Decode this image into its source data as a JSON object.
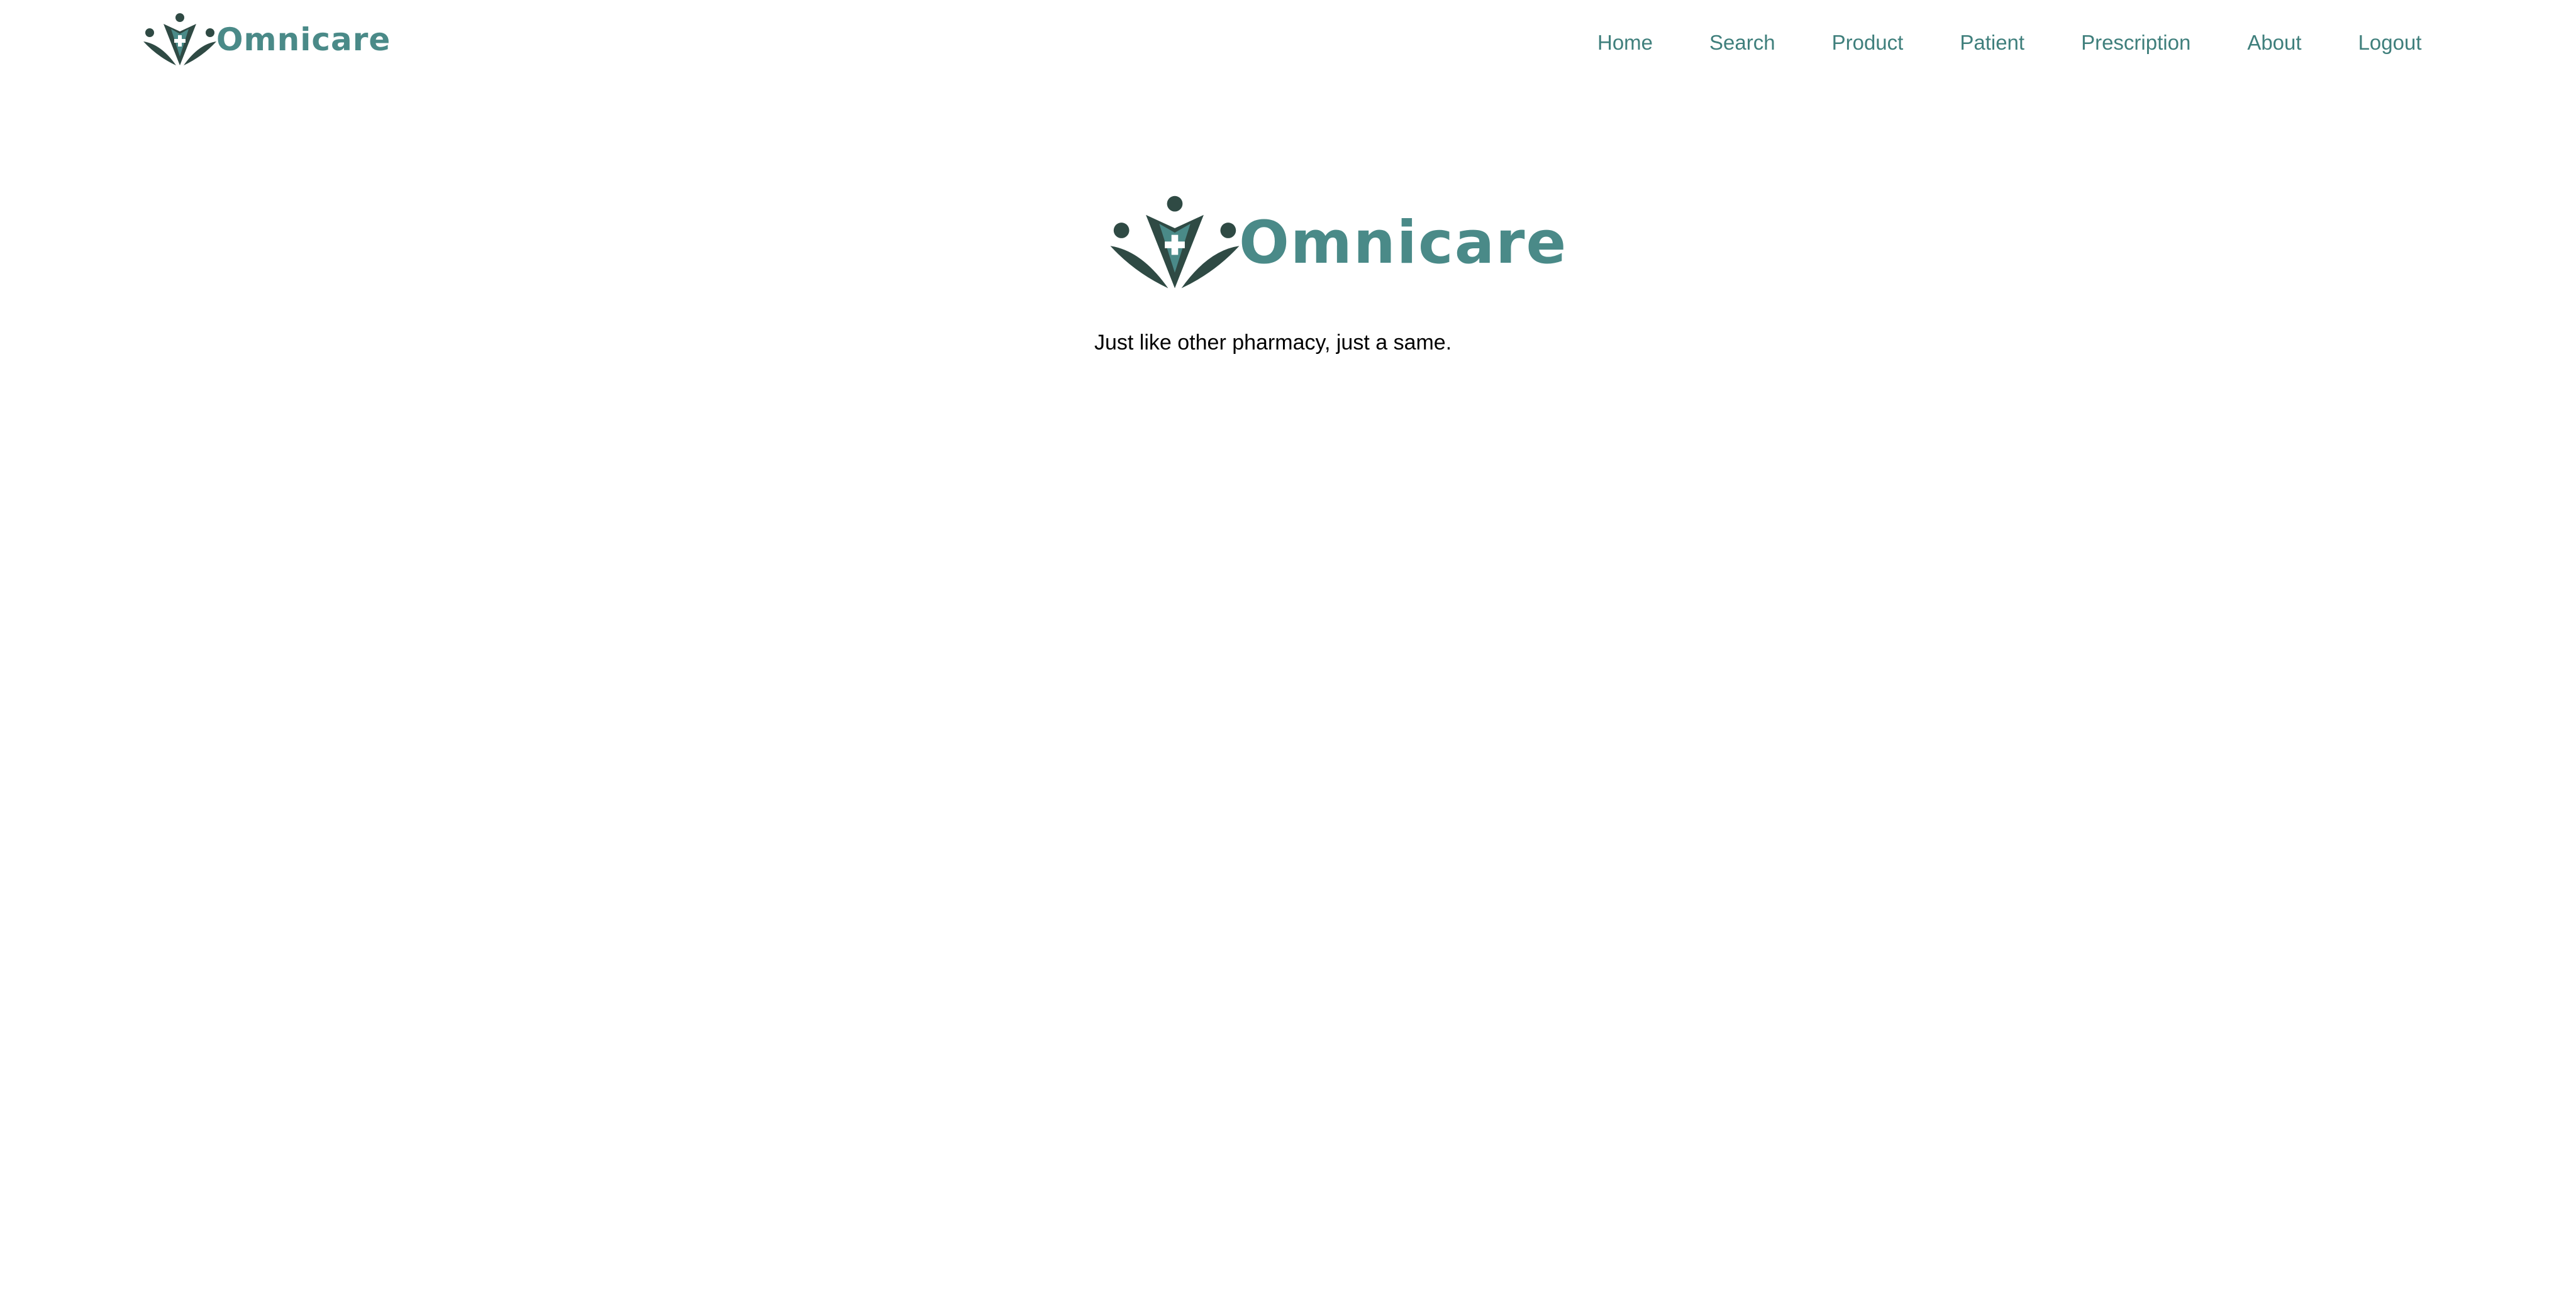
{
  "brand": {
    "name": "Omnicare",
    "accent_color": "#4a8a88",
    "mark_color": "#2f4a44",
    "logo_icon": "omnicare-people-cross-icon"
  },
  "nav": {
    "items": [
      {
        "label": "Home"
      },
      {
        "label": "Search"
      },
      {
        "label": "Product"
      },
      {
        "label": "Patient"
      },
      {
        "label": "Prescription"
      },
      {
        "label": "About"
      },
      {
        "label": "Logout"
      }
    ],
    "link_color": "#3f7f7c"
  },
  "hero": {
    "brand_name": "Omnicare",
    "tagline": "Just like other pharmacy, just a same."
  }
}
